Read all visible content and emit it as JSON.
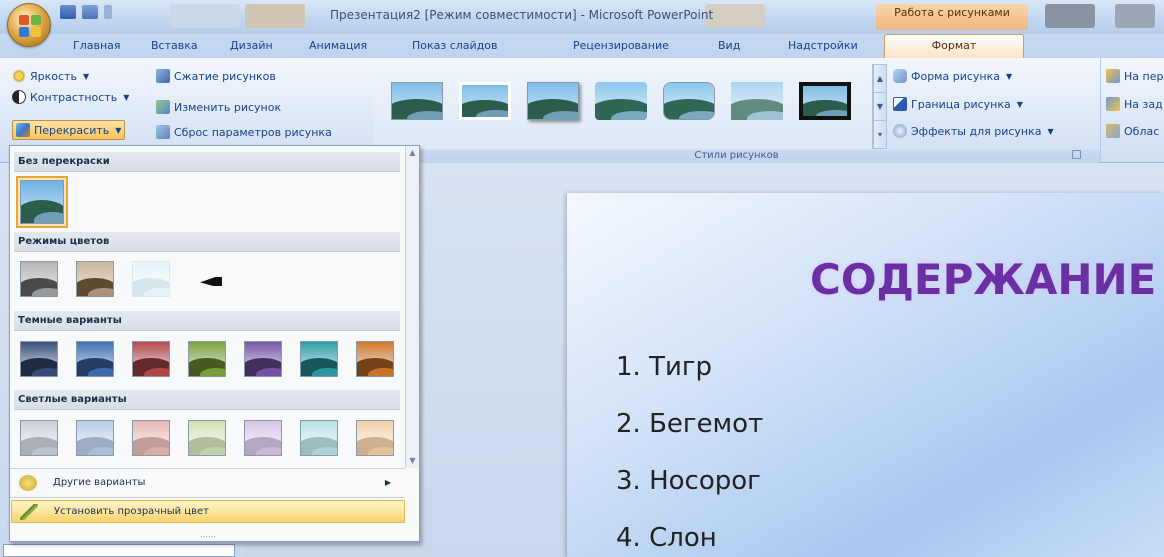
{
  "window": {
    "title": "Презентация2 [Режим совместимости] - Microsoft PowerPoint",
    "context_tab_title": "Работа с рисунками"
  },
  "tabs": [
    {
      "label": "Главная",
      "active": false
    },
    {
      "label": "Вставка",
      "active": false
    },
    {
      "label": "Дизайн",
      "active": false
    },
    {
      "label": "Анимация",
      "active": false
    },
    {
      "label": "Показ слайдов",
      "active": false
    },
    {
      "label": "Рецензирование",
      "active": false
    },
    {
      "label": "Вид",
      "active": false
    },
    {
      "label": "Надстройки",
      "active": false
    },
    {
      "label": "Формат",
      "active": true
    }
  ],
  "ribbon": {
    "adjust": {
      "brightness": "Яркость",
      "contrast": "Контрастность",
      "recolor": "Перекрасить",
      "compress": "Сжатие рисунков",
      "change": "Изменить рисунок",
      "reset": "Сброс параметров рисунка"
    },
    "styles_group_label": "Стили рисунков",
    "styles_count": 7,
    "shape": "Форма рисунка",
    "border": "Граница рисунка",
    "effects": "Эффекты для рисунка",
    "arrange": {
      "front": "На пер",
      "back": "На зад",
      "pane": "Облас"
    }
  },
  "recolor_menu": {
    "sections": {
      "none": "Без перекраски",
      "modes": "Режимы цветов",
      "dark": "Темные варианты",
      "light": "Светлые варианты"
    },
    "color_modes": [
      "grayscale",
      "sepia",
      "washout",
      "black-white"
    ],
    "dark_variants": [
      "#3a4f7a",
      "#3f6fb5",
      "#b84a4a",
      "#7fa33c",
      "#7a55a8",
      "#2f9fa8",
      "#d4782a"
    ],
    "light_variants": [
      "#c9ced8",
      "#b8cbe6",
      "#e6b7b4",
      "#cfe0b5",
      "#d5c5e3",
      "#b9e0e3",
      "#f1cfa9"
    ],
    "more_variants": "Другие варианты",
    "set_transparent": "Установить прозрачный цвет"
  },
  "slide": {
    "title": "СОДЕРЖАНИЕ",
    "items": [
      "1. Тигр",
      "2. Бегемот",
      "3. Носорог",
      "4. Слон"
    ]
  },
  "colors": {
    "accent_orange": "#f9c55b",
    "title_purple": "#6a2fa3",
    "ribbon_text": "#15428b"
  }
}
